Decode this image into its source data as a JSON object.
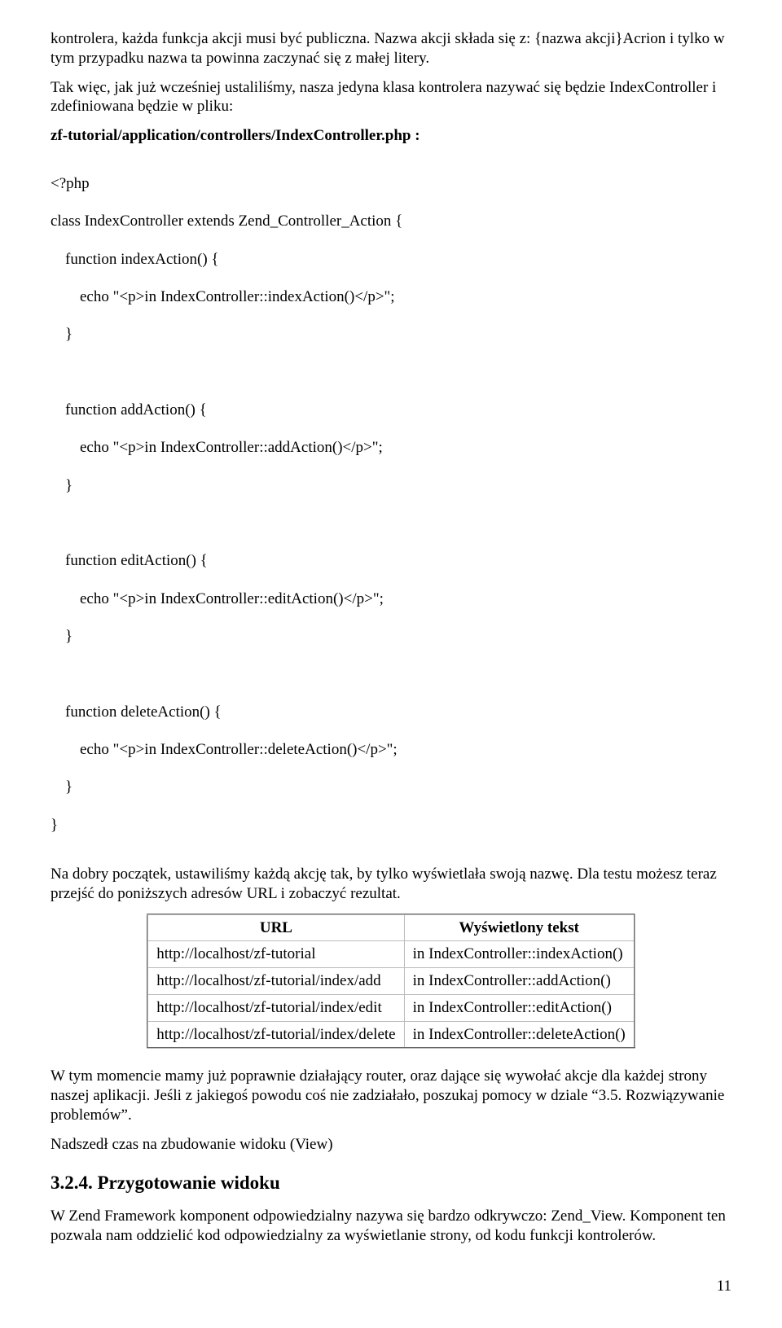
{
  "p1": "kontrolera, każda funkcja akcji musi być publiczna. Nazwa akcji składa się z: {nazwa akcji}Acrion i tylko w tym przypadku nazwa ta powinna zaczynać się z małej litery.",
  "p2": "Tak więc, jak już wcześniej ustaliliśmy, nasza jedyna klasa kontrolera nazywać się będzie IndexController i zdefiniowana będzie w pliku:",
  "p3": "zf-tutorial/application/controllers/IndexController.php :",
  "code": {
    "l1": "<?php",
    "l2": "class IndexController extends Zend_Controller_Action {",
    "l3": "function indexAction() {",
    "l4": "echo \"<p>in IndexController::indexAction()</p>\";",
    "l5": "}",
    "l6": "function addAction() {",
    "l7": "echo \"<p>in IndexController::addAction()</p>\";",
    "l8": "}",
    "l9": "function editAction() {",
    "l10": "echo \"<p>in IndexController::editAction()</p>\";",
    "l11": "}",
    "l12": "function deleteAction() {",
    "l13": "echo \"<p>in IndexController::deleteAction()</p>\";",
    "l14": "}",
    "l15": "}"
  },
  "p4": "Na dobry początek, ustawiliśmy każdą akcję tak, by tylko wyświetlała swoją nazwę. Dla testu możesz teraz przejść do poniższych adresów URL i zobaczyć rezultat.",
  "table": {
    "head": {
      "c1": "URL",
      "c2": "Wyświetlony tekst"
    },
    "rows": [
      {
        "c1": "http://localhost/zf-tutorial",
        "c2": "in IndexController::indexAction()"
      },
      {
        "c1": "http://localhost/zf-tutorial/index/add",
        "c2": "in IndexController::addAction()"
      },
      {
        "c1": "http://localhost/zf-tutorial/index/edit",
        "c2": "in IndexController::editAction()"
      },
      {
        "c1": "http://localhost/zf-tutorial/index/delete",
        "c2": "in IndexController::deleteAction()"
      }
    ]
  },
  "p5": "W tym momencie mamy już poprawnie działający router, oraz dające się wywołać akcje dla każdej strony naszej aplikacji. Jeśli z jakiegoś powodu coś nie zadziałało, poszukaj pomocy w dziale “3.5. Rozwiązywanie problemów”.",
  "p6": "Nadszedł czas na zbudowanie widoku (View)",
  "h3": "3.2.4. Przygotowanie widoku",
  "p7": "W Zend Framework komponent odpowiedzialny nazywa się bardzo odkrywczo: Zend_View. Komponent ten pozwala nam oddzielić kod odpowiedzialny za wyświetlanie strony, od kodu funkcji kontrolerów.",
  "page": "11"
}
